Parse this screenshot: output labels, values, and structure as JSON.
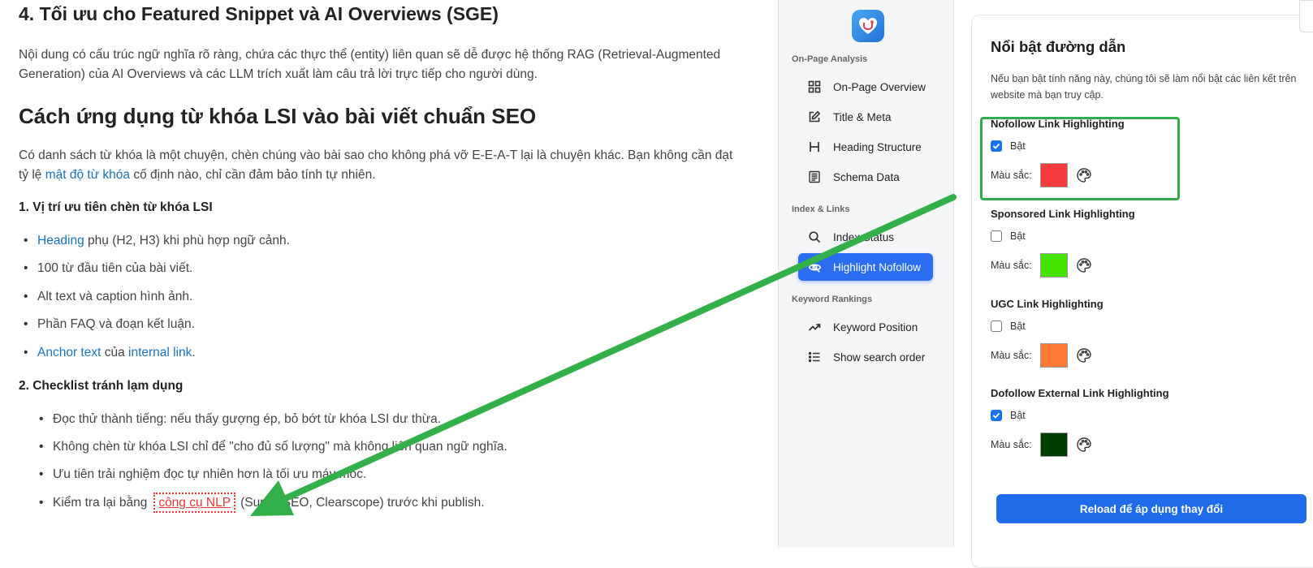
{
  "article": {
    "h4_title": "4. Tối ưu cho Featured Snippet và AI Overviews (SGE)",
    "p1": "Nội dung có cấu trúc ngữ nghĩa rõ ràng, chứa các thực thể (entity) liên quan sẽ dễ được hệ thống RAG (Retrieval-Augmented Generation) của AI Overviews và các LLM trích xuất làm câu trả lời trực tiếp cho người dùng.",
    "h2_title": "Cách ứng dụng từ khóa LSI vào bài viết chuẩn SEO",
    "p2_before": "Có danh sách từ khóa là một chuyện, chèn chúng vào bài sao cho không phá vỡ E-E-A-T lại là chuyện khác. Bạn không cần đạt tỷ lệ ",
    "p2_link": "mật độ từ khóa",
    "p2_after": " cố định nào, chỉ cần đảm bảo tính tự nhiên.",
    "s1_title": "1. Vị trí ưu tiên chèn từ khóa LSI",
    "s1_item1_link": "Heading",
    "s1_item1_rest": " phụ (H2, H3) khi phù hợp ngữ cảnh.",
    "s1_item2": "100 từ đầu tiên của bài viết.",
    "s1_item3": "Alt text và caption hình ảnh.",
    "s1_item4": "Phần FAQ và đoạn kết luận.",
    "s1_item5_link1": "Anchor text",
    "s1_item5_mid": " của ",
    "s1_item5_link2": "internal link",
    "s1_item5_end": ".",
    "s2_title": "2. Checklist tránh lạm dụng",
    "s2_item1": "Đọc thử thành tiếng: nếu thấy gượng ép, bỏ bớt từ khóa LSI dư thừa.",
    "s2_item2": "Không chèn từ khóa LSI chỉ để \"cho đủ số lượng\" mà không liên quan ngữ nghĩa.",
    "s2_item3": "Ưu tiên trải nghiệm đọc tự nhiên hơn là tối ưu máy móc.",
    "s2_item4_before": "Kiểm tra lại bằng",
    "s2_item4_link": "công cụ NLP",
    "s2_item4_after": "(Surfer SEO, Clearscope) trước khi publish."
  },
  "sidebar": {
    "section1": "On-Page Analysis",
    "items1": [
      {
        "label": "On-Page Overview",
        "icon": "grid-icon"
      },
      {
        "label": "Title & Meta",
        "icon": "edit-icon"
      },
      {
        "label": "Heading Structure",
        "icon": "heading-icon"
      },
      {
        "label": "Schema Data",
        "icon": "schema-icon"
      }
    ],
    "section2": "Index & Links",
    "items2": [
      {
        "label": "Index Status",
        "icon": "search-icon"
      },
      {
        "label": "Highlight Nofollow",
        "icon": "eye-off-icon",
        "active": true
      }
    ],
    "section3": "Keyword Rankings",
    "items3": [
      {
        "label": "Keyword Position",
        "icon": "trending-up-icon"
      },
      {
        "label": "Show search order",
        "icon": "list-order-icon"
      }
    ]
  },
  "panel": {
    "title": "Nổi bật đường dẫn",
    "description": "Nếu bạn bật tính năng này, chúng tôi sẽ làm nổi bật các liên kết trên website mà bạn truy cập.",
    "groups": [
      {
        "title": "Nofollow Link Highlighting",
        "toggle_label": "Bật",
        "checked": true,
        "color_label": "Màu sắc:",
        "color": "#f53b3b"
      },
      {
        "title": "Sponsored Link Highlighting",
        "toggle_label": "Bật",
        "checked": false,
        "color_label": "Màu sắc:",
        "color": "#47e300"
      },
      {
        "title": "UGC Link Highlighting",
        "toggle_label": "Bật",
        "checked": false,
        "color_label": "Màu sắc:",
        "color": "#ff7a36"
      },
      {
        "title": "Dofollow External Link Highlighting",
        "toggle_label": "Bật",
        "checked": true,
        "color_label": "Màu sắc:",
        "color": "#003d00"
      }
    ],
    "reload_button": "Reload để áp dụng thay đổi"
  },
  "colors": {
    "accent": "#2a6df0",
    "annotation_arrow": "#34b04a",
    "link": "#1a73b9"
  }
}
